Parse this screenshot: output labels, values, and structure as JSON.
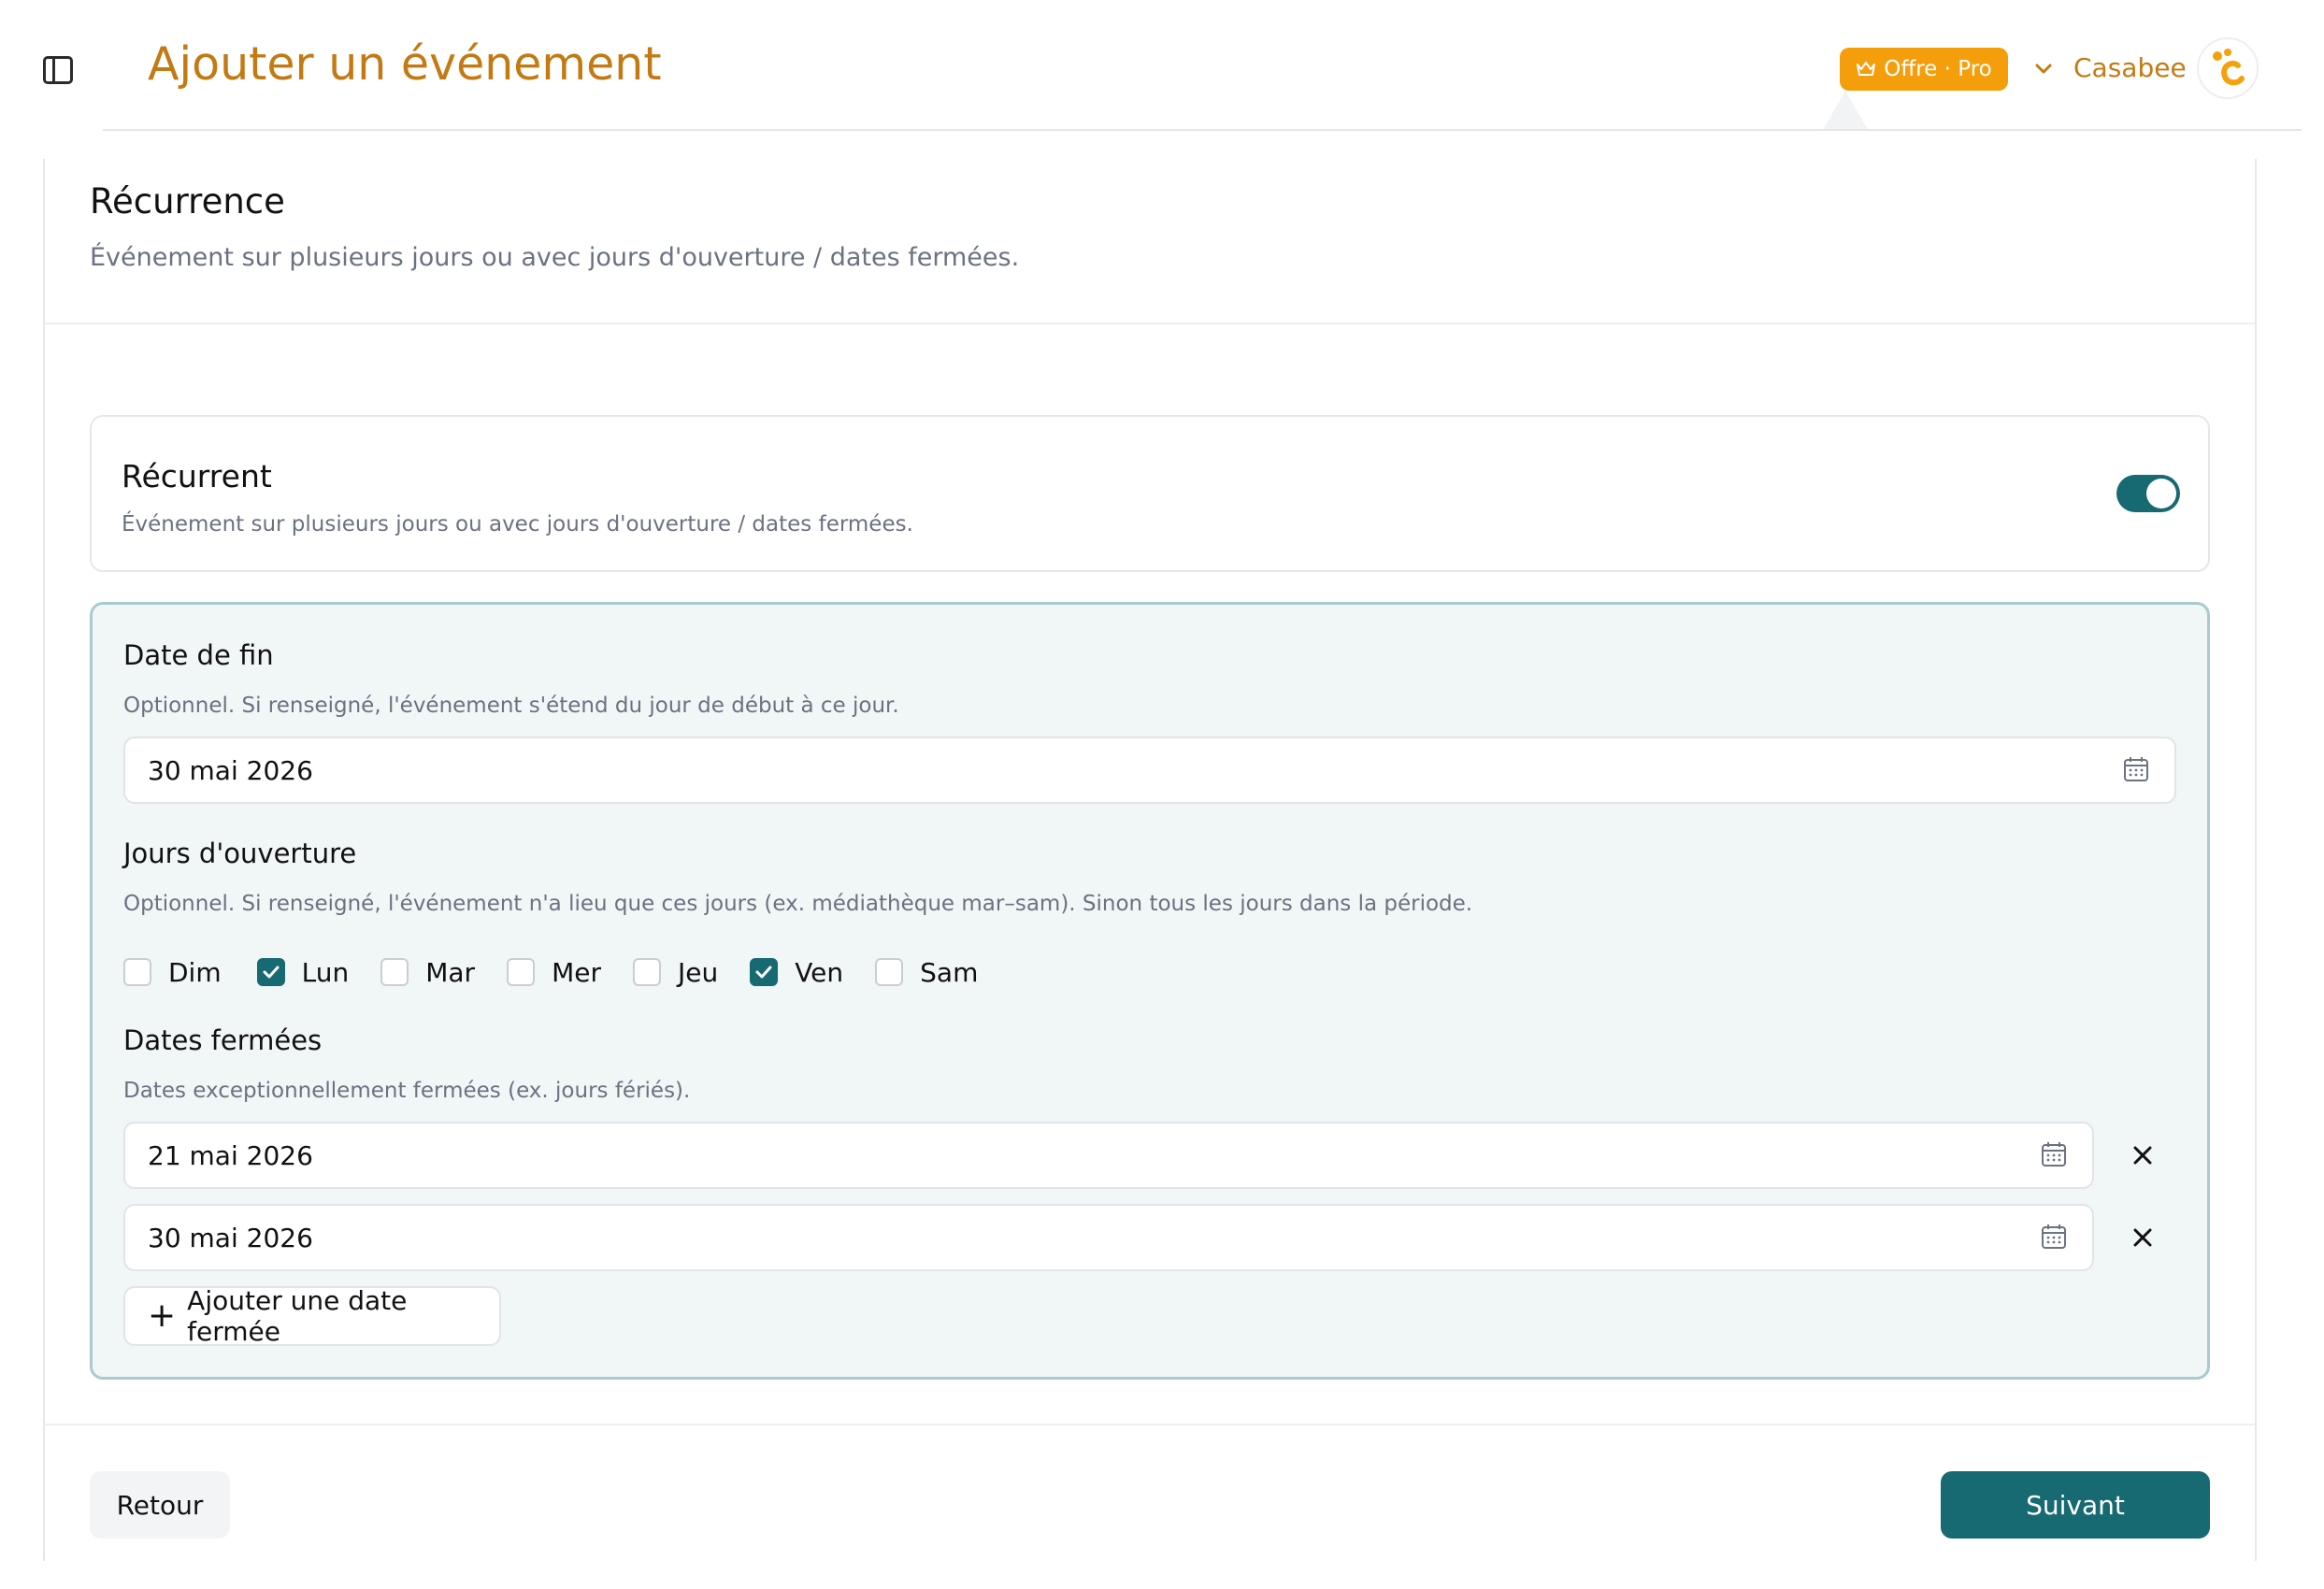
{
  "header": {
    "title": "Ajouter un événement",
    "offer_badge": "Offre · Pro",
    "org_name": "Casabee"
  },
  "section": {
    "title": "Récurrence",
    "description": "Événement sur plusieurs jours ou avec jours d'ouverture / dates fermées."
  },
  "recurrent": {
    "title": "Récurrent",
    "description": "Événement sur plusieurs jours ou avec jours d'ouverture / dates fermées.",
    "enabled": true
  },
  "end_date": {
    "label": "Date de fin",
    "help": "Optionnel. Si renseigné, l'événement s'étend du jour de début à ce jour.",
    "value": "30 mai 2026"
  },
  "open_days": {
    "label": "Jours d'ouverture",
    "help": "Optionnel. Si renseigné, l'événement n'a lieu que ces jours (ex. médiathèque mar–sam). Sinon tous les jours dans la période.",
    "days": [
      {
        "label": "Dim",
        "checked": false
      },
      {
        "label": "Lun",
        "checked": true
      },
      {
        "label": "Mar",
        "checked": false
      },
      {
        "label": "Mer",
        "checked": false
      },
      {
        "label": "Jeu",
        "checked": false
      },
      {
        "label": "Ven",
        "checked": true
      },
      {
        "label": "Sam",
        "checked": false
      }
    ]
  },
  "closed_dates": {
    "label": "Dates fermées",
    "help": "Dates exceptionnellement fermées (ex. jours fériés).",
    "dates": [
      "21 mai 2026",
      "30 mai 2026"
    ],
    "add_label": "Ajouter une date fermée"
  },
  "footer": {
    "back_label": "Retour",
    "next_label": "Suivant"
  },
  "colors": {
    "accent": "#176a72",
    "brand": "#c47a12",
    "badge": "#f59e0b"
  }
}
